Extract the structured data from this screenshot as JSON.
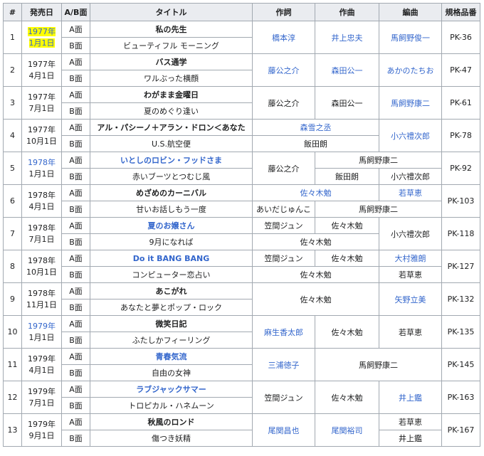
{
  "headers": {
    "num": "#",
    "date": "発売日",
    "side": "A/B面",
    "title": "タイトル",
    "lyrics": "作詞",
    "composer": "作曲",
    "arranger": "編曲",
    "catalog": "規格品番"
  },
  "sides": {
    "a": "A面",
    "b": "B面"
  },
  "rows": [
    {
      "num": "1",
      "year": "1977年",
      "day": "1月1日",
      "catalog": "PK-36",
      "a_title": "私の先生",
      "b_title": "ビューティフル モーニング",
      "lyrics": "橋本淳",
      "composer": "井上忠夫",
      "arranger": "馬飼野俊一"
    },
    {
      "num": "2",
      "year": "1977年",
      "day": "4月1日",
      "catalog": "PK-47",
      "a_title": "バス通学",
      "b_title": "ワルぶった横顔",
      "lyrics": "藤公之介",
      "composer": "森田公一",
      "arranger": "あかのたちお"
    },
    {
      "num": "3",
      "year": "1977年",
      "day": "7月1日",
      "catalog": "PK-61",
      "a_title": "わがまま金曜日",
      "b_title": "夏のめぐり逢い",
      "lyrics": "藤公之介",
      "composer": "森田公一",
      "arranger": "馬飼野康二"
    },
    {
      "num": "4",
      "year": "1977年",
      "day": "10月1日",
      "catalog": "PK-78",
      "a_title": "アル・パシーノ＋アラン・ドロン＜あなた",
      "b_title": "U.S.航空便",
      "a_lyrics_composer": "森雪之丞",
      "b_lyrics_composer": "飯田朗",
      "arranger": "小六禮次郎"
    },
    {
      "num": "5",
      "year": "1978年",
      "day": "1月1日",
      "catalog": "PK-92",
      "a_title": "いとしのロビン・フッドさま",
      "b_title": "赤いブーツとつむじ風",
      "lyrics": "藤公之介",
      "a_composer_arranger": "馬飼野康二",
      "b_composer": "飯田朗",
      "b_arranger": "小六禮次郎"
    },
    {
      "num": "6",
      "year": "1978年",
      "day": "4月1日",
      "catalog": "PK-103",
      "a_title": "めざめのカーニバル",
      "b_title": "甘いお話しもう一度",
      "a_lyrics_composer": "佐々木勉",
      "a_arranger": "若草恵",
      "b_lyrics": "あいだじゅんこ",
      "b_composer_arranger": "馬飼野康二"
    },
    {
      "num": "7",
      "year": "1978年",
      "day": "7月1日",
      "catalog": "PK-118",
      "a_title": "夏のお嬢さん",
      "b_title": "9月になれば",
      "a_lyrics": "笠間ジュン",
      "a_composer": "佐々木勉",
      "b_lyrics_composer": "佐々木勉",
      "arranger": "小六禮次郎"
    },
    {
      "num": "8",
      "year": "1978年",
      "day": "10月1日",
      "catalog": "PK-127",
      "a_title": "Do it BANG BANG",
      "b_title": "コンピューター恋占い",
      "a_lyrics": "笠間ジュン",
      "a_composer": "佐々木勉",
      "a_arranger": "大村雅朗",
      "b_lyrics_composer": "佐々木勉",
      "b_arranger": "若草恵"
    },
    {
      "num": "9",
      "year": "1978年",
      "day": "11月1日",
      "catalog": "PK-132",
      "a_title": "あこがれ",
      "b_title": "あなたと夢とポップ・ロック",
      "lyrics_composer": "佐々木勉",
      "arranger": "矢野立美"
    },
    {
      "num": "10",
      "year": "1979年",
      "day": "1月1日",
      "catalog": "PK-135",
      "a_title": "微笑日記",
      "b_title": "ふたしかフィーリング",
      "lyrics": "麻生香太郎",
      "composer": "佐々木勉",
      "arranger": "若草恵"
    },
    {
      "num": "11",
      "year": "1979年",
      "day": "4月1日",
      "catalog": "PK-145",
      "a_title": "青春気流",
      "b_title": "自由の女神",
      "lyrics": "三浦徳子",
      "composer_arranger": "馬飼野康二"
    },
    {
      "num": "12",
      "year": "1979年",
      "day": "7月1日",
      "catalog": "PK-163",
      "a_title": "ラブジャックサマー",
      "b_title": "トロピカル・ハネムーン",
      "lyrics": "笠間ジュン",
      "composer": "佐々木勉",
      "arranger": "井上鑑"
    },
    {
      "num": "13",
      "year": "1979年",
      "day": "9月1日",
      "catalog": "PK-167",
      "a_title": "秋風のロンド",
      "b_title": "傷つき妖精",
      "lyrics": "尾関昌也",
      "composer": "尾関裕司",
      "a_arranger": "若草恵",
      "b_arranger": "井上鑑"
    }
  ],
  "colors": {
    "header_bg": "#eaecf0",
    "border": "#a2a9b1",
    "link": "#3366cc",
    "highlight": "#ffff00"
  }
}
